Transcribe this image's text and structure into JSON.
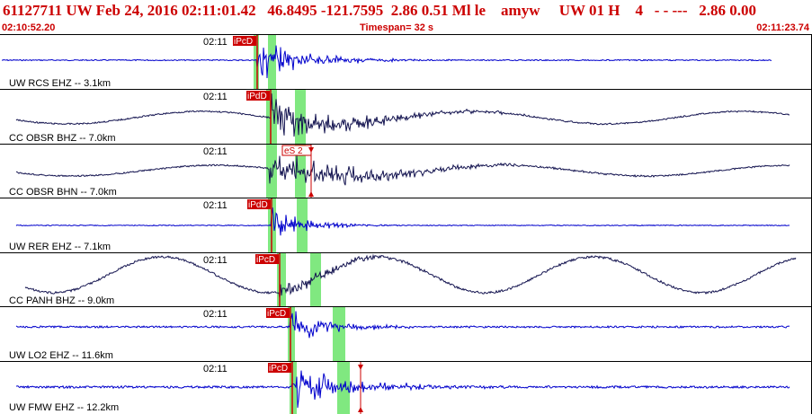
{
  "header": {
    "title": "61127711 UW Feb 24, 2016 02:11:01.42   46.8495 -121.7595  2.86 0.51 Ml le    amyw     UW 01 H    4   - - ---   2.86 0.00",
    "start_time": "02:10:52.20",
    "timespan": "Timespan=  32 s",
    "end_time": "02:11:23.74"
  },
  "colors": {
    "title": "#cc0000",
    "ehz_trace": "#0000cc",
    "bh_trace": "#141450",
    "pick_window": "#80e880",
    "pick_marker": "#cc0000"
  },
  "panels": [
    {
      "id": "rcs",
      "label": "UW RCS EHZ -- 3.1km",
      "time": "02:11",
      "pick": "iPcD",
      "color": "blue"
    },
    {
      "id": "obsr-bhz",
      "label": "CC OBSR BHZ -- 7.0km",
      "time": "02:11",
      "pick": "iPdD",
      "color": "dark"
    },
    {
      "id": "obsr-bhn",
      "label": "CC OBSR BHN -- 7.0km",
      "time": "02:11",
      "pick": "eS 2",
      "color": "dark"
    },
    {
      "id": "rer",
      "label": "UW RER EHZ -- 7.1km",
      "time": "02:11",
      "pick": "iPdD",
      "color": "blue"
    },
    {
      "id": "panh",
      "label": "CC PANH BHZ -- 9.0km",
      "time": "02:11",
      "pick": "iPcD",
      "color": "dark"
    },
    {
      "id": "lo2",
      "label": "UW LO2 EHZ -- 11.6km",
      "time": "02:11",
      "pick": "iPcD",
      "color": "blue"
    },
    {
      "id": "fmw",
      "label": "UW FMW EHZ -- 12.2km",
      "time": "02:11",
      "pick": "iPcD",
      "color": "blue"
    }
  ]
}
